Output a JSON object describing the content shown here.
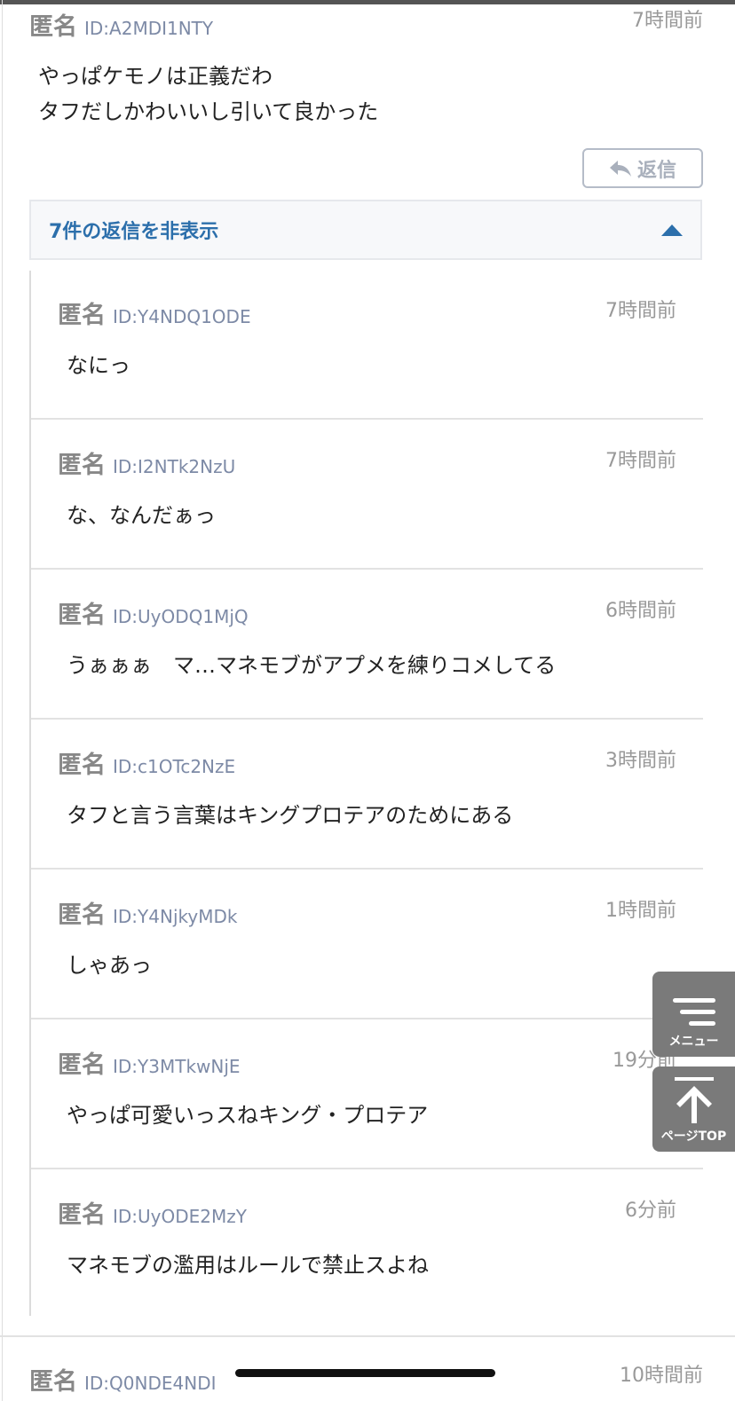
{
  "main_comment": {
    "name": "匿名",
    "id": "ID:A2MDI1NTY",
    "time": "7時間前",
    "body": "やっぱケモノは正義だわ\nタフだしかわいいし引いて良かった",
    "reply_label": "返信"
  },
  "toggle": {
    "label": "7件の返信を非表示"
  },
  "replies": [
    {
      "name": "匿名",
      "id": "ID:Y4NDQ1ODE",
      "time": "7時間前",
      "body": "なにっ"
    },
    {
      "name": "匿名",
      "id": "ID:I2NTk2NzU",
      "time": "7時間前",
      "body": "な、なんだぁっ"
    },
    {
      "name": "匿名",
      "id": "ID:UyODQ1MjQ",
      "time": "6時間前",
      "body": "うぁぁぁ　マ…マネモブがアプメを練りコメしてる"
    },
    {
      "name": "匿名",
      "id": "ID:c1OTc2NzE",
      "time": "3時間前",
      "body": "タフと言う言葉はキングプロテアのためにある"
    },
    {
      "name": "匿名",
      "id": "ID:Y4NjkyMDk",
      "time": "1時間前",
      "body": "しゃあっ"
    },
    {
      "name": "匿名",
      "id": "ID:Y3MTkwNjE",
      "time": "19分前",
      "body": "やっぱ可愛いっスねキング・プロテア"
    },
    {
      "name": "匿名",
      "id": "ID:UyODE2MzY",
      "time": "6分前",
      "body": "マネモブの濫用はルールで禁止スよね"
    }
  ],
  "next_comment": {
    "name": "匿名",
    "id": "ID:Q0NDE4NDI",
    "time": "10時間前"
  },
  "floating": {
    "menu_label": "メニュー",
    "top_label": "ページTOP"
  },
  "colors": {
    "accent": "#2c6fab",
    "id_text": "#7d8aa6",
    "float_bg": "#7a7a7a"
  }
}
